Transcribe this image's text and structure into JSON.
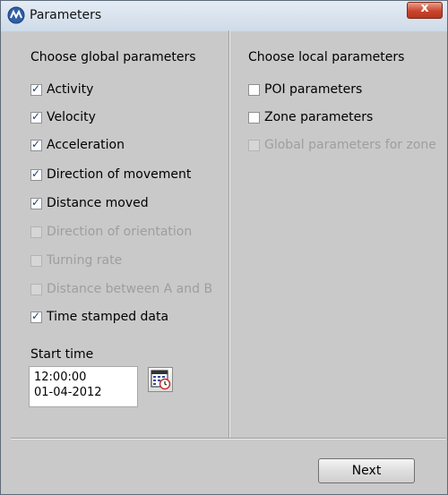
{
  "window": {
    "title": "Parameters",
    "close_glyph": "x"
  },
  "global": {
    "title": "Choose global parameters",
    "items": [
      {
        "label": "Activity",
        "checked": true,
        "enabled": true
      },
      {
        "label": "Velocity",
        "checked": true,
        "enabled": true
      },
      {
        "label": "Acceleration",
        "checked": true,
        "enabled": true
      },
      {
        "label": "Direction of movement",
        "checked": true,
        "enabled": true
      },
      {
        "label": "Distance moved",
        "checked": true,
        "enabled": true
      },
      {
        "label": "Direction of orientation",
        "checked": false,
        "enabled": false
      },
      {
        "label": "Turning rate",
        "checked": false,
        "enabled": false
      },
      {
        "label": "Distance between A and B",
        "checked": false,
        "enabled": false
      },
      {
        "label": "Time stamped data",
        "checked": true,
        "enabled": true
      }
    ]
  },
  "local": {
    "title": "Choose local parameters",
    "items": [
      {
        "label": "POI parameters",
        "checked": false,
        "enabled": true
      },
      {
        "label": "Zone parameters",
        "checked": false,
        "enabled": true
      },
      {
        "label": "Global parameters for zone",
        "checked": false,
        "enabled": false
      }
    ]
  },
  "start_time": {
    "label": "Start time",
    "time": "12:00:00",
    "date": "01-04-2012"
  },
  "buttons": {
    "next": "Next"
  }
}
